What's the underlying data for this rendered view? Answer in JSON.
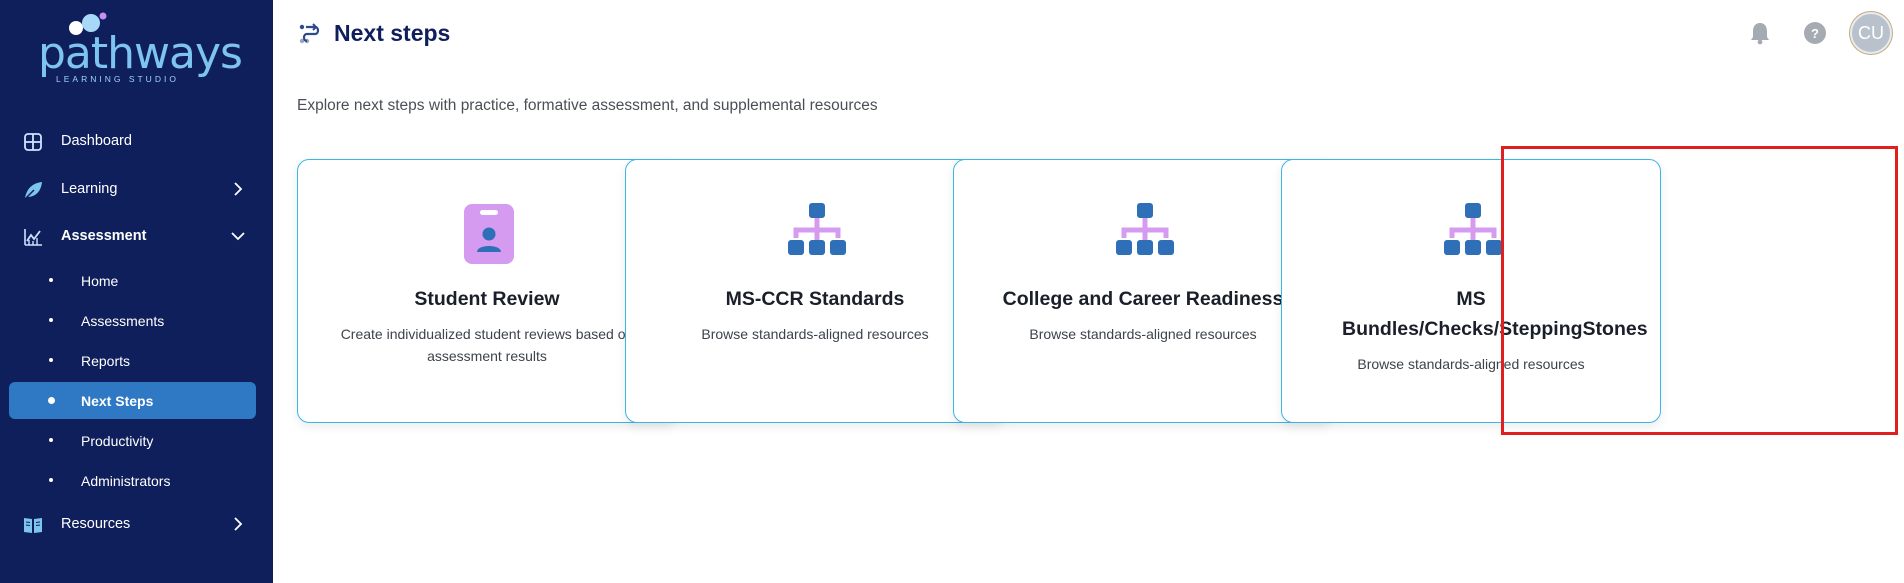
{
  "brand": {
    "name": "pathways",
    "tagline": "LEARNING STUDIO"
  },
  "sidebar": {
    "items": [
      {
        "label": "Dashboard",
        "icon": "dashboard-icon"
      },
      {
        "label": "Learning",
        "icon": "leaf-icon",
        "expandable": true
      },
      {
        "label": "Assessment",
        "icon": "chart-line-icon",
        "expanded": true
      },
      {
        "label": "Resources",
        "icon": "book-icon",
        "expandable": true
      }
    ],
    "assessment_sub": [
      {
        "label": "Home"
      },
      {
        "label": "Assessments"
      },
      {
        "label": "Reports"
      },
      {
        "label": "Next Steps",
        "active": true
      },
      {
        "label": "Productivity"
      },
      {
        "label": "Administrators"
      }
    ]
  },
  "header": {
    "title": "Next steps",
    "title_icon": "steps-icon",
    "avatar_initials": "CU",
    "help_glyph": "?"
  },
  "main": {
    "subtitle": "Explore next steps with practice, formative assessment, and supplemental resources",
    "cards": [
      {
        "title": "Student Review",
        "description": "Create individualized student reviews based on assessment results",
        "icon": "id-badge-icon"
      },
      {
        "title": "MS-CCR Standards",
        "description": "Browse standards-aligned resources",
        "icon": "hierarchy-icon"
      },
      {
        "title": "College and Career Readiness",
        "description": "Browse standards-aligned resources",
        "icon": "hierarchy-icon"
      },
      {
        "title": "MS Bundles/Checks/SteppingStones",
        "description": "Browse standards-aligned resources",
        "icon": "hierarchy-icon",
        "highlighted": true
      }
    ]
  },
  "colors": {
    "sidebar_bg": "#0f1f5c",
    "active_item": "#2f78c4",
    "card_border": "#3cb6e5",
    "icon_purple": "#d49bf0",
    "icon_blue": "#2e6fb8",
    "highlight": "#e02020"
  }
}
